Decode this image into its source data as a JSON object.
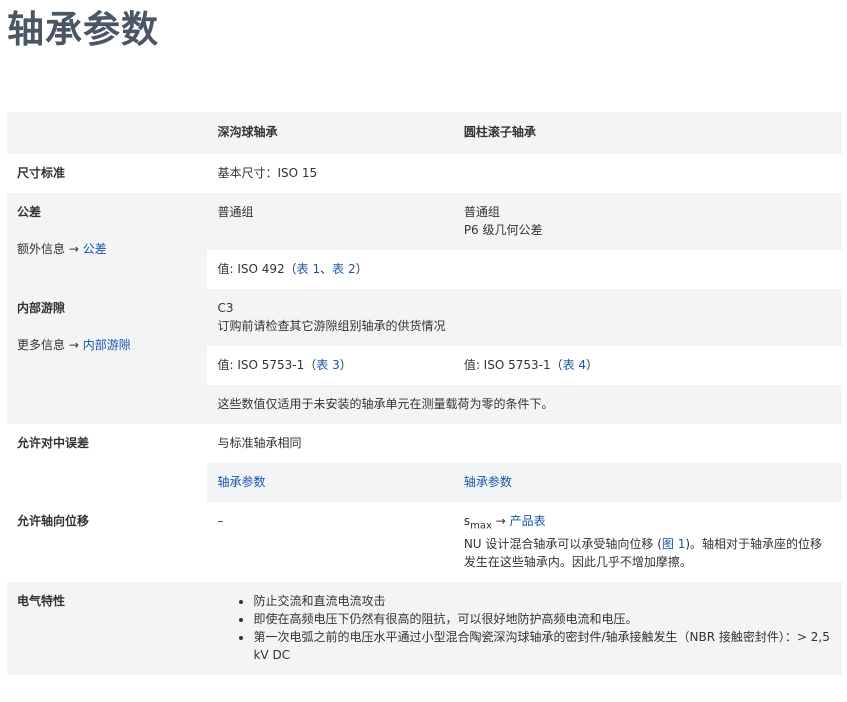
{
  "page_title": "轴承参数",
  "header": {
    "col_deep_groove": "深沟球轴承",
    "col_cylindrical": "圆柱滚子轴承"
  },
  "rows": {
    "dimension": {
      "label": "尺寸标准",
      "value": "基本尺寸：ISO 15"
    },
    "tolerance": {
      "label": "公差",
      "note_prefix": "额外信息 → ",
      "note_link": "公差",
      "deep_groove": "普通组",
      "cylindrical_line1": "普通组",
      "cylindrical_line2": "P6 级几何公差",
      "value_prefix": "值: ISO 492（",
      "value_link1": "表 1",
      "value_sep": "、",
      "value_link2": "表 2",
      "value_suffix": "）"
    },
    "clearance": {
      "label": "内部游隙",
      "note_prefix": "更多信息 → ",
      "note_link": "内部游隙",
      "line1": "C3",
      "line2": "订购前请检查其它游隙组别轴承的供货情况",
      "deep_prefix": "值: ISO 5753-1（",
      "deep_link": "表 3",
      "deep_suffix": "）",
      "cyl_prefix": "值: ISO 5753-1（",
      "cyl_link": "表 4",
      "cyl_suffix": "）",
      "footnote": "这些数值仅适用于未安装的轴承单元在测量载荷为零的条件下。"
    },
    "misalignment": {
      "label": "允许对中误差",
      "value": "与标准轴承相同",
      "deep_link": "轴承参数",
      "cyl_link": "轴承参数"
    },
    "axial": {
      "label": "允许轴向位移",
      "deep_value": "–",
      "s_max": "s",
      "s_max_sub": "max",
      "arrow": " → ",
      "product_link": "产品表",
      "desc_prefix": "NU 设计混合轴承可以承受轴向位移 (",
      "desc_link": "图 1",
      "desc_suffix": ")。轴相对于轴承座的位移发生在这些轴承内。因此几乎不增加摩擦。"
    },
    "electrical": {
      "label": "电气特性",
      "bullets": [
        "防止交流和直流电流攻击",
        "即使在高频电压下仍然有很高的阻抗，可以很好地防护高频电流和电压。",
        "第一次电弧之前的电压水平通过小型混合陶瓷深沟球轴承的密封件/轴承接触发生（NBR 接触密封件）：> 2,5 kV DC"
      ]
    }
  }
}
